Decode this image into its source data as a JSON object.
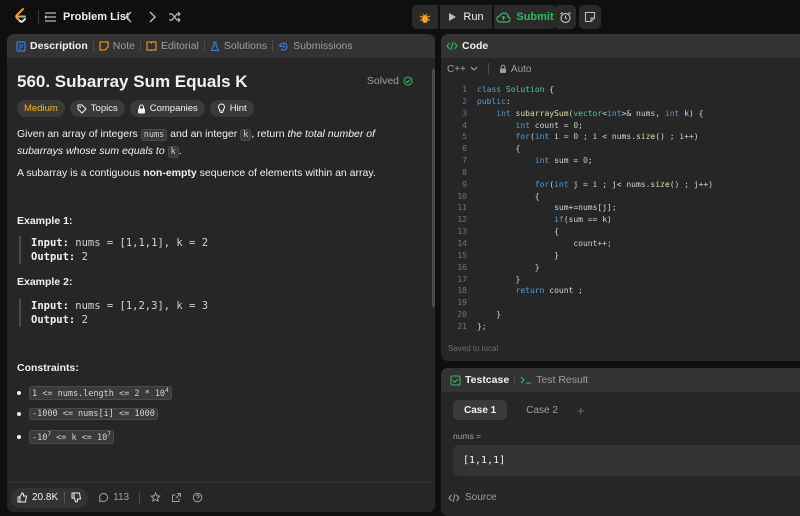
{
  "topbar": {
    "problem_list_label": "Problem List",
    "run_label": "Run",
    "submit_label": "Submit"
  },
  "left_panel": {
    "tabs": [
      "Description",
      "Note",
      "Editorial",
      "Solutions",
      "Submissions"
    ],
    "title": "560. Subarray Sum Equals K",
    "solved_label": "Solved",
    "badges": {
      "difficulty": "Medium",
      "topics": "Topics",
      "companies": "Companies",
      "hint": "Hint"
    },
    "description": {
      "p1_a": "Given an array of integers ",
      "p1_code1": "nums",
      "p1_b": " and an integer ",
      "p1_code2": "k",
      "p1_c": ", return ",
      "p1_em": "the total number of subarrays whose sum equals to",
      "p1_code3": "k",
      "p1_d": ".",
      "p2_a": "A subarray is a contiguous ",
      "p2_bold": "non-empty",
      "p2_b": " sequence of elements within an array."
    },
    "examples": [
      {
        "title": "Example 1:",
        "input_label": "Input:",
        "input": "nums = [1,1,1], k = 2",
        "output_label": "Output:",
        "output": "2"
      },
      {
        "title": "Example 2:",
        "input_label": "Input:",
        "input": "nums = [1,2,3], k = 3",
        "output_label": "Output:",
        "output": "2"
      }
    ],
    "constraints_title": "Constraints:",
    "constraints": [
      {
        "a": "1 <= nums.length <= 2 * 10",
        "sup": "4",
        "b": ""
      },
      {
        "a": "-1000 <= nums[i] <= 1000",
        "sup": "",
        "b": ""
      },
      {
        "a": "-10",
        "sup": "7",
        "b": " <= k <= 10",
        "sup2": "7"
      }
    ],
    "bottom": {
      "likes": "20.8K",
      "comments": "113"
    }
  },
  "code_panel": {
    "title": "Code",
    "language": "C++",
    "auto_label": "Auto",
    "saved_label": "Saved to local",
    "lines": [
      "class Solution {",
      "public:",
      "    int subarraySum(vector<int>& nums, int k) {",
      "        int count = 0;",
      "        for(int i = 0 ; i < nums.size() ; i++)",
      "        {",
      "            int sum = 0;",
      "",
      "            for(int j = i ; j< nums.size() ; j++)",
      "            {",
      "                sum+=nums[j];",
      "                if(sum == k)",
      "                {",
      "                    count++;",
      "                }",
      "            }",
      "        }",
      "        return count ;",
      "",
      "    }",
      "};"
    ],
    "line_numbers": [
      "1",
      "2",
      "3",
      "4",
      "5",
      "6",
      "7",
      "8",
      "9",
      "10",
      "11",
      "12",
      "13",
      "14",
      "15",
      "16",
      "17",
      "18",
      "19",
      "20",
      "21"
    ]
  },
  "test_panel": {
    "tab_testcase": "Testcase",
    "tab_result": "Test Result",
    "cases": [
      "Case 1",
      "Case 2"
    ],
    "arg_label": "nums =",
    "arg_value": "[1,1,1]",
    "source_label": "Source"
  },
  "colors": {
    "accent_green": "#2cbb5d",
    "medium_yellow": "#ffb800",
    "logo_orange": "#ffa116",
    "tab_blue": "#3c7fe1"
  }
}
